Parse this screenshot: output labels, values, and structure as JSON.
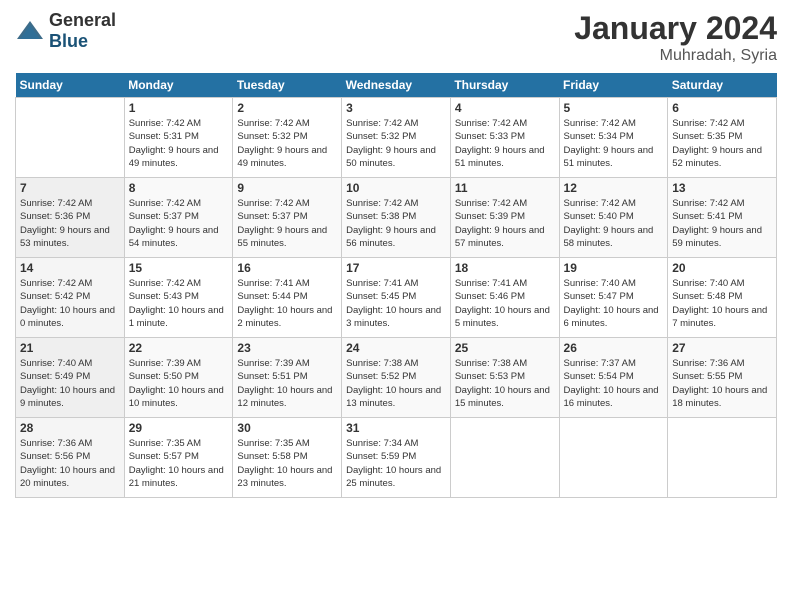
{
  "header": {
    "logo_general": "General",
    "logo_blue": "Blue",
    "month_title": "January 2024",
    "location": "Muhradah, Syria"
  },
  "days_of_week": [
    "Sunday",
    "Monday",
    "Tuesday",
    "Wednesday",
    "Thursday",
    "Friday",
    "Saturday"
  ],
  "weeks": [
    [
      {
        "day": "",
        "sunrise": "",
        "sunset": "",
        "daylight": ""
      },
      {
        "day": "1",
        "sunrise": "7:42 AM",
        "sunset": "5:31 PM",
        "daylight": "9 hours and 49 minutes."
      },
      {
        "day": "2",
        "sunrise": "7:42 AM",
        "sunset": "5:32 PM",
        "daylight": "9 hours and 49 minutes."
      },
      {
        "day": "3",
        "sunrise": "7:42 AM",
        "sunset": "5:32 PM",
        "daylight": "9 hours and 50 minutes."
      },
      {
        "day": "4",
        "sunrise": "7:42 AM",
        "sunset": "5:33 PM",
        "daylight": "9 hours and 51 minutes."
      },
      {
        "day": "5",
        "sunrise": "7:42 AM",
        "sunset": "5:34 PM",
        "daylight": "9 hours and 51 minutes."
      },
      {
        "day": "6",
        "sunrise": "7:42 AM",
        "sunset": "5:35 PM",
        "daylight": "9 hours and 52 minutes."
      }
    ],
    [
      {
        "day": "7",
        "sunrise": "7:42 AM",
        "sunset": "5:36 PM",
        "daylight": "9 hours and 53 minutes."
      },
      {
        "day": "8",
        "sunrise": "7:42 AM",
        "sunset": "5:37 PM",
        "daylight": "9 hours and 54 minutes."
      },
      {
        "day": "9",
        "sunrise": "7:42 AM",
        "sunset": "5:37 PM",
        "daylight": "9 hours and 55 minutes."
      },
      {
        "day": "10",
        "sunrise": "7:42 AM",
        "sunset": "5:38 PM",
        "daylight": "9 hours and 56 minutes."
      },
      {
        "day": "11",
        "sunrise": "7:42 AM",
        "sunset": "5:39 PM",
        "daylight": "9 hours and 57 minutes."
      },
      {
        "day": "12",
        "sunrise": "7:42 AM",
        "sunset": "5:40 PM",
        "daylight": "9 hours and 58 minutes."
      },
      {
        "day": "13",
        "sunrise": "7:42 AM",
        "sunset": "5:41 PM",
        "daylight": "9 hours and 59 minutes."
      }
    ],
    [
      {
        "day": "14",
        "sunrise": "7:42 AM",
        "sunset": "5:42 PM",
        "daylight": "10 hours and 0 minutes."
      },
      {
        "day": "15",
        "sunrise": "7:42 AM",
        "sunset": "5:43 PM",
        "daylight": "10 hours and 1 minute."
      },
      {
        "day": "16",
        "sunrise": "7:41 AM",
        "sunset": "5:44 PM",
        "daylight": "10 hours and 2 minutes."
      },
      {
        "day": "17",
        "sunrise": "7:41 AM",
        "sunset": "5:45 PM",
        "daylight": "10 hours and 3 minutes."
      },
      {
        "day": "18",
        "sunrise": "7:41 AM",
        "sunset": "5:46 PM",
        "daylight": "10 hours and 5 minutes."
      },
      {
        "day": "19",
        "sunrise": "7:40 AM",
        "sunset": "5:47 PM",
        "daylight": "10 hours and 6 minutes."
      },
      {
        "day": "20",
        "sunrise": "7:40 AM",
        "sunset": "5:48 PM",
        "daylight": "10 hours and 7 minutes."
      }
    ],
    [
      {
        "day": "21",
        "sunrise": "7:40 AM",
        "sunset": "5:49 PM",
        "daylight": "10 hours and 9 minutes."
      },
      {
        "day": "22",
        "sunrise": "7:39 AM",
        "sunset": "5:50 PM",
        "daylight": "10 hours and 10 minutes."
      },
      {
        "day": "23",
        "sunrise": "7:39 AM",
        "sunset": "5:51 PM",
        "daylight": "10 hours and 12 minutes."
      },
      {
        "day": "24",
        "sunrise": "7:38 AM",
        "sunset": "5:52 PM",
        "daylight": "10 hours and 13 minutes."
      },
      {
        "day": "25",
        "sunrise": "7:38 AM",
        "sunset": "5:53 PM",
        "daylight": "10 hours and 15 minutes."
      },
      {
        "day": "26",
        "sunrise": "7:37 AM",
        "sunset": "5:54 PM",
        "daylight": "10 hours and 16 minutes."
      },
      {
        "day": "27",
        "sunrise": "7:36 AM",
        "sunset": "5:55 PM",
        "daylight": "10 hours and 18 minutes."
      }
    ],
    [
      {
        "day": "28",
        "sunrise": "7:36 AM",
        "sunset": "5:56 PM",
        "daylight": "10 hours and 20 minutes."
      },
      {
        "day": "29",
        "sunrise": "7:35 AM",
        "sunset": "5:57 PM",
        "daylight": "10 hours and 21 minutes."
      },
      {
        "day": "30",
        "sunrise": "7:35 AM",
        "sunset": "5:58 PM",
        "daylight": "10 hours and 23 minutes."
      },
      {
        "day": "31",
        "sunrise": "7:34 AM",
        "sunset": "5:59 PM",
        "daylight": "10 hours and 25 minutes."
      },
      {
        "day": "",
        "sunrise": "",
        "sunset": "",
        "daylight": ""
      },
      {
        "day": "",
        "sunrise": "",
        "sunset": "",
        "daylight": ""
      },
      {
        "day": "",
        "sunrise": "",
        "sunset": "",
        "daylight": ""
      }
    ]
  ]
}
